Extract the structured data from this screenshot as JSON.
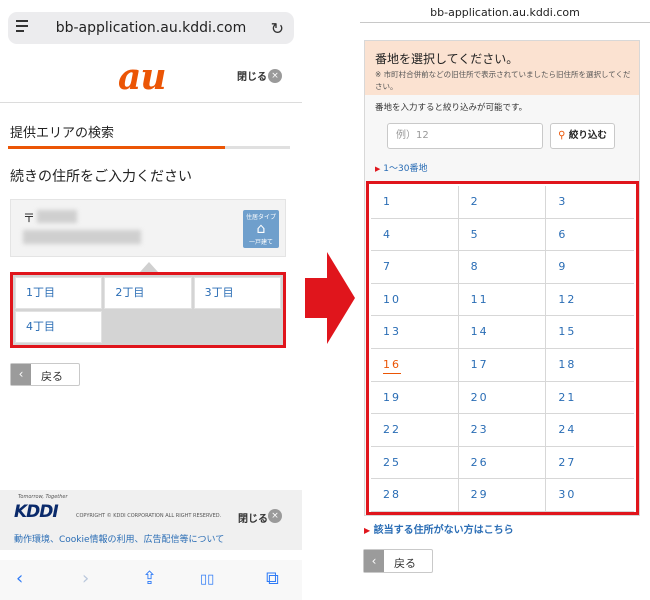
{
  "left": {
    "url": "bb-application.au.kddi.com",
    "logo": "au",
    "close_label": "閉じる",
    "close_icon": "×",
    "area_title": "提供エリアの検索",
    "progress_fraction": 0.77,
    "prompt": "続きの住所をご入力ください",
    "postal_mark": "〒",
    "house_badge": {
      "top": "住居タイプ",
      "icon": "house-icon",
      "bottom": "一戸建て"
    },
    "chome_options": [
      "1丁目",
      "2丁目",
      "3丁目",
      "4丁目"
    ],
    "back_label": "戻る",
    "footer": {
      "tagline": "Tomorrow, Together",
      "logo": "KDDI",
      "copyright": "COPYRIGHT © KDDI CORPORATION ALL RIGHT RESERVED.",
      "close_label": "閉じる",
      "links": "動作環境、Cookie情報の利用、広告配信等について"
    },
    "safari": [
      "‹",
      "›",
      "⇪",
      "▯▯",
      "⧉"
    ]
  },
  "right": {
    "url": "bb-application.au.kddi.com",
    "header_title": "番地を選択してください。",
    "header_note": "※ 市町村合併前などの旧住所で表示されていましたら旧住所を選択してください。",
    "hint": "番地を入力すると絞り込みが可能です。",
    "input_placeholder": "例）12",
    "filter_label": "絞り込む",
    "range_label": "1～30番地",
    "banchi": [
      "1",
      "2",
      "3",
      "4",
      "5",
      "6",
      "7",
      "8",
      "9",
      "10",
      "11",
      "12",
      "13",
      "14",
      "15",
      "16",
      "17",
      "18",
      "19",
      "20",
      "21",
      "22",
      "23",
      "24",
      "25",
      "26",
      "27",
      "28",
      "29",
      "30"
    ],
    "selected": "16",
    "no_address_link": "該当する住所がない方はこちら",
    "back_label": "戻る"
  },
  "colors": {
    "accent": "#eb5505",
    "highlight": "#e0151c",
    "link": "#2a6db5"
  }
}
